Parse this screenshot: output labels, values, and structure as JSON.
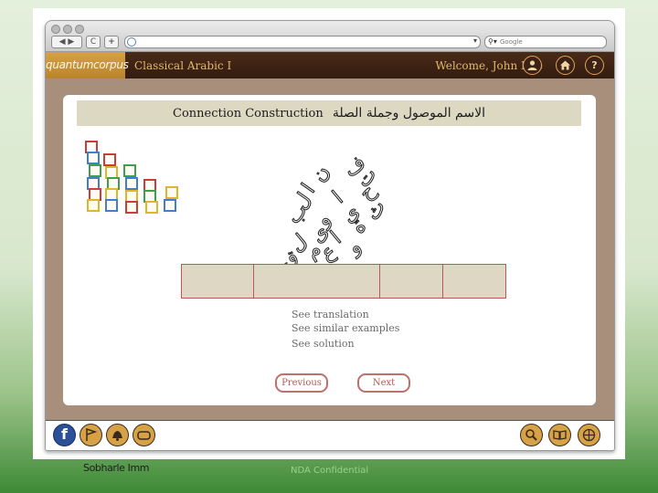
{
  "browser": {
    "search_placeholder": "Google",
    "search_icon": "magnifier-dropdown-icon",
    "back_forward_label": "◀ ▶",
    "reload_label": "C",
    "new_tab_label": "+"
  },
  "appbar": {
    "logo": "quantumcorpus",
    "course_title": "Classical Arabic I",
    "welcome": "Welcome, John Doe",
    "help_label": "?",
    "icons": [
      "user-icon",
      "home-icon",
      "help-icon"
    ]
  },
  "exercise": {
    "title_en": "Connection Construction",
    "title_ar": "الاسم الموصول وجملة الصلة",
    "scrambled_letters": [
      "ف",
      "ت",
      "ح",
      "ن",
      "ا",
      "ل",
      "ب",
      "ا",
      "ي",
      "ه",
      "و",
      "ى",
      "ا",
      "ل",
      "م",
      "ع",
      "ث",
      "ق",
      "و"
    ],
    "slot_count": 4,
    "links": {
      "translation": "See translation",
      "similar": "See similar examples",
      "solution": "See solution"
    },
    "previous_label": "Previous",
    "next_label": "Next"
  },
  "bottombar": {
    "left_tools": [
      "facebook-icon",
      "flag-icon",
      "bell-icon",
      "scroll-icon"
    ],
    "right_tools": [
      "search-icon",
      "book-icon",
      "compass-icon"
    ],
    "facebook_label": "f"
  },
  "footer": {
    "left_text": "Sobharle Imm",
    "center_text": "NDA Confidential"
  },
  "colors": {
    "appbar": "#3b2216",
    "accent_gold": "#d7a246",
    "title_band": "#dcd8c2",
    "pill_border": "#c0706a",
    "content_bg": "#a78f7c"
  }
}
